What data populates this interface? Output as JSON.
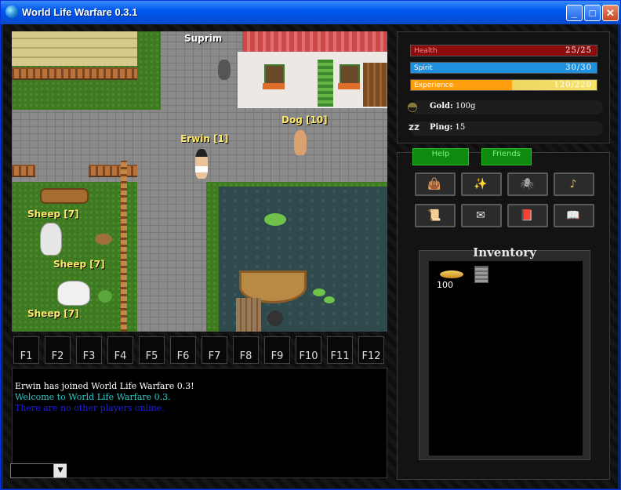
{
  "window": {
    "title": "World Life Warfare 0.3.1",
    "controls": [
      "minimize",
      "maximize",
      "close"
    ]
  },
  "map": {
    "labels": [
      {
        "id": "suprim",
        "text": "Suprim"
      },
      {
        "id": "dog",
        "text": "Dog [10]"
      },
      {
        "id": "erwin",
        "text": "Erwin [1]"
      },
      {
        "id": "sheep1",
        "text": "Sheep [7]"
      },
      {
        "id": "sheep2",
        "text": "Sheep [7]"
      },
      {
        "id": "sheep3",
        "text": "Sheep [7]"
      }
    ]
  },
  "hotkeys": [
    "F1",
    "F2",
    "F3",
    "F4",
    "F5",
    "F6",
    "F7",
    "F8",
    "F9",
    "F10",
    "F11",
    "F12"
  ],
  "chat": {
    "lines": [
      {
        "text": "Erwin has joined World Life Warfare 0.3!",
        "color": "#ffffff"
      },
      {
        "text": "Welcome to World Life Warfare 0.3.",
        "color": "#33c6c6"
      },
      {
        "text": "There are no other players online.",
        "color": "#1f1fdc"
      }
    ],
    "input_value": ""
  },
  "stats": {
    "health": {
      "label": "Health",
      "value": "25/25",
      "fraction": 1.0,
      "color": "#8b0c0c"
    },
    "spirit": {
      "label": "Spirit",
      "value": "30/30",
      "fraction": 1.0,
      "color": "#1f8fe0"
    },
    "experience": {
      "label": "Experience",
      "value": "120/220",
      "fraction": 0.545,
      "color": "#ff9f0f"
    },
    "gold": {
      "label": "Gold:",
      "value": "100g"
    },
    "ping": {
      "label": "Ping:",
      "value": "15"
    }
  },
  "tabs": {
    "help": "Help",
    "friends": "Friends"
  },
  "skills": [
    {
      "name": "bag-icon",
      "glyph": "👜"
    },
    {
      "name": "sparkle-icon",
      "glyph": "✨"
    },
    {
      "name": "bug-icon",
      "glyph": "🕷"
    },
    {
      "name": "harp-icon",
      "glyph": "♪"
    },
    {
      "name": "scroll-icon",
      "glyph": "📜"
    },
    {
      "name": "letter-icon",
      "glyph": "✉"
    },
    {
      "name": "book-icon",
      "glyph": "📕"
    },
    {
      "name": "open-book-icon",
      "glyph": "📖"
    }
  ],
  "inventory": {
    "title": "Inventory",
    "items": [
      {
        "name": "gold-coins",
        "quantity": "100"
      },
      {
        "name": "stone-tablet",
        "quantity": ""
      }
    ]
  }
}
